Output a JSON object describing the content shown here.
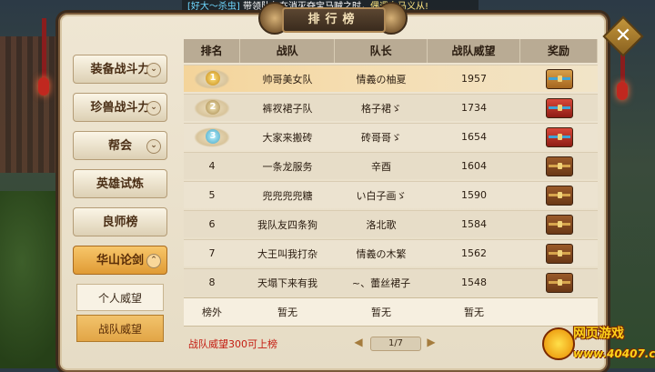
{
  "announcement": {
    "tag": "[好大～杀虫]",
    "text_before": "带领队友在消灭夺宝马贼之时，",
    "text_highlight": "偶遇白马义从!"
  },
  "title": "排行榜",
  "menu": {
    "items": [
      {
        "label": "装备战斗力",
        "chevron": "⌄"
      },
      {
        "label": "珍兽战斗力",
        "chevron": "⌄"
      },
      {
        "label": "帮会",
        "chevron": "⌄"
      },
      {
        "label": "英雄试炼"
      },
      {
        "label": "良师榜"
      },
      {
        "label": "华山论剑",
        "chevron": "⌃",
        "active": true
      }
    ],
    "sub_items": [
      {
        "label": "个人威望"
      },
      {
        "label": "战队威望",
        "selected": true
      }
    ]
  },
  "table": {
    "headers": [
      "排名",
      "战队",
      "队长",
      "战队威望",
      "奖励"
    ],
    "rows": [
      {
        "rank": "1",
        "team": "帅哥美女队",
        "captain": "情義の柚夏",
        "prestige": "1957",
        "reward": "chest-gold"
      },
      {
        "rank": "2",
        "team": "裤衩裙子队",
        "captain": "格子裙ゞ",
        "prestige": "1734",
        "reward": "chest-red"
      },
      {
        "rank": "3",
        "team": "大家来搬砖",
        "captain": "砖哥哥ゞ",
        "prestige": "1654",
        "reward": "chest-red"
      },
      {
        "rank": "4",
        "team": "一条龙服务",
        "captain": "辛酉",
        "prestige": "1604",
        "reward": "chest"
      },
      {
        "rank": "5",
        "team": "兜兜兜兜糖",
        "captain": "い白子画ゞ",
        "prestige": "1590",
        "reward": "chest"
      },
      {
        "rank": "6",
        "team": "我队友四条狗",
        "captain": "洛北歌",
        "prestige": "1584",
        "reward": "chest"
      },
      {
        "rank": "7",
        "team": "大王叫我打杂",
        "captain": "情義の木繁",
        "prestige": "1562",
        "reward": "chest"
      },
      {
        "rank": "8",
        "team": "天塌下来有我",
        "captain": "~、蕾丝裙子",
        "prestige": "1548",
        "reward": "chest"
      }
    ]
  },
  "self_row": {
    "rank": "榜外",
    "team": "暂无",
    "captain": "暂无",
    "prestige": "暂无"
  },
  "hint": "战队威望300可上榜",
  "pager": {
    "prev": "◀",
    "page": "1/7",
    "next": "▶"
  },
  "watermark": {
    "line1": "网页游戏",
    "line2": "www.40407.com"
  },
  "colors": {
    "accent": "#e09b35",
    "hint_red": "#c41d12"
  }
}
